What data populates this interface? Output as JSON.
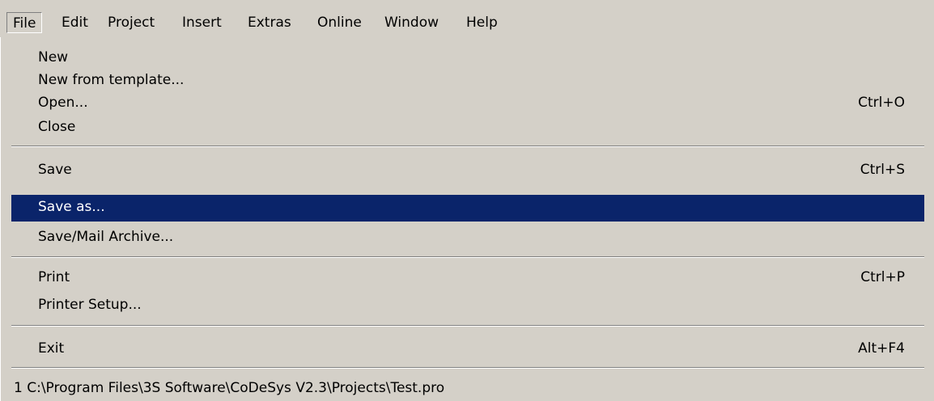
{
  "menubar": {
    "items": [
      {
        "label": "File"
      },
      {
        "label": "Edit"
      },
      {
        "label": "Project"
      },
      {
        "label": "Insert"
      },
      {
        "label": "Extras"
      },
      {
        "label": "Online"
      },
      {
        "label": "Window"
      },
      {
        "label": "Help"
      }
    ],
    "open_menu": "File"
  },
  "file_menu": {
    "items": [
      {
        "label": "New",
        "shortcut": ""
      },
      {
        "label": "New from template...",
        "shortcut": ""
      },
      {
        "label": "Open...",
        "shortcut": "Ctrl+O"
      },
      {
        "label": "Close",
        "shortcut": ""
      },
      {
        "label": "Save",
        "shortcut": "Ctrl+S"
      },
      {
        "label": "Save as...",
        "shortcut": "",
        "highlighted": true
      },
      {
        "label": "Save/Mail Archive...",
        "shortcut": ""
      },
      {
        "label": "Print",
        "shortcut": "Ctrl+P"
      },
      {
        "label": "Printer Setup...",
        "shortcut": ""
      },
      {
        "label": "Exit",
        "shortcut": "Alt+F4"
      },
      {
        "label": "1 C:\\Program Files\\3S Software\\CoDeSys V2.3\\Projects\\Test.pro",
        "shortcut": ""
      }
    ]
  },
  "colors": {
    "menu_background": "#d4d0c8",
    "highlight_background": "#0a246a",
    "highlight_text": "#ffffff"
  }
}
